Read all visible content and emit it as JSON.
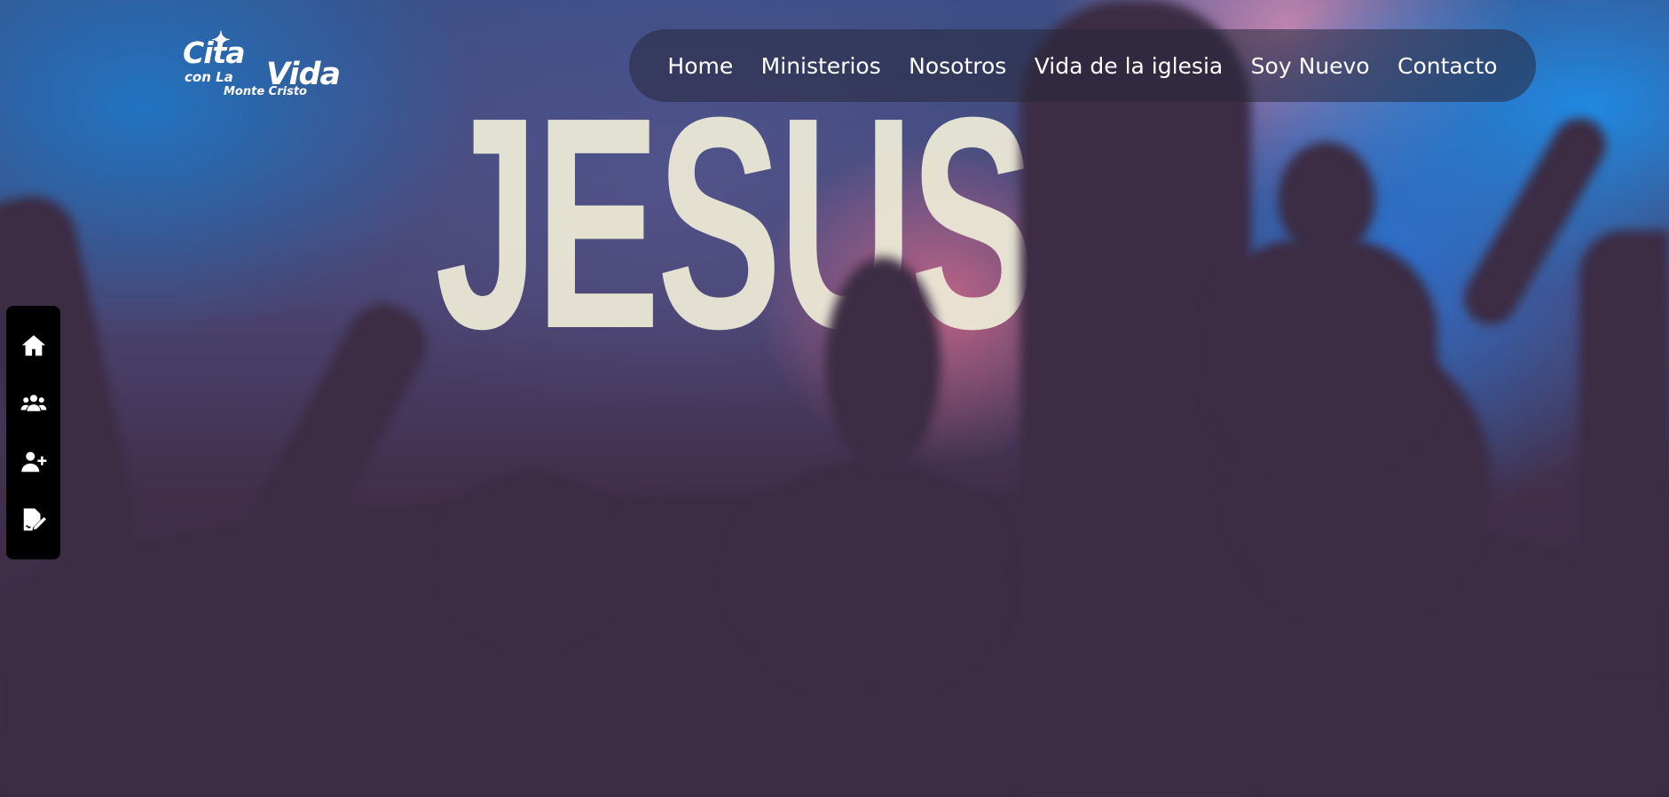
{
  "logo": {
    "line1": "Cita",
    "line2": "con La",
    "line2b": "Vida",
    "line3": "Monte Cristo"
  },
  "hero": {
    "backdrop_text": "JESUS"
  },
  "nav": {
    "items": [
      {
        "label": "Home"
      },
      {
        "label": "Ministerios"
      },
      {
        "label": "Nosotros"
      },
      {
        "label": "Vida de la iglesia"
      },
      {
        "label": "Soy Nuevo"
      },
      {
        "label": "Contacto"
      }
    ]
  },
  "side_dock": {
    "icons": [
      "home-icon",
      "users-group-icon",
      "user-plus-icon",
      "signature-document-icon"
    ]
  },
  "colors": {
    "nav_pill_bg": "rgba(40,40,60,0.55)",
    "dock_bg": "#000000",
    "text": "#ffffff",
    "backdrop_text": "#ece9d6"
  }
}
